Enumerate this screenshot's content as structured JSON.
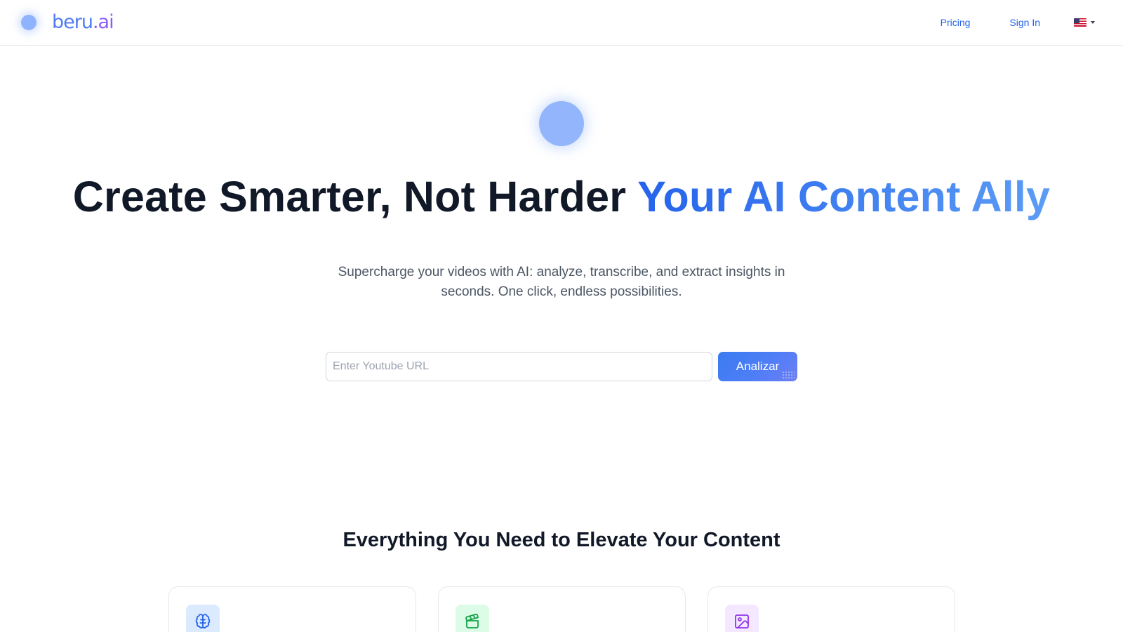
{
  "brand": {
    "name_main": "beru",
    "name_suffix": ".ai"
  },
  "nav": {
    "pricing": "Pricing",
    "sign_in": "Sign In",
    "language_flag_icon": "us-flag-icon"
  },
  "hero": {
    "title_main": "Create Smarter, Not Harder",
    "title_accent": "Your AI Content Ally",
    "subtitle": "Supercharge your videos with AI: analyze, transcribe, and extract insights in seconds. One click, endless possibilities."
  },
  "search": {
    "placeholder": "Enter Youtube URL",
    "value": "",
    "button_label": "Analizar"
  },
  "features": {
    "title": "Everything You Need to Elevate Your Content",
    "cards": [
      {
        "icon": "brain-icon",
        "icon_color": "#2563eb",
        "icon_bg": "#dbeafe"
      },
      {
        "icon": "clapperboard-icon",
        "icon_color": "#16a34a",
        "icon_bg": "#dcfce7"
      },
      {
        "icon": "image-icon",
        "icon_color": "#9333ea",
        "icon_bg": "#f3e8ff"
      }
    ]
  },
  "colors": {
    "accent": "#2563eb",
    "button": "#4f7ef7",
    "text_dark": "#111827",
    "text_muted": "#4b5563",
    "border": "#e5e7eb"
  }
}
